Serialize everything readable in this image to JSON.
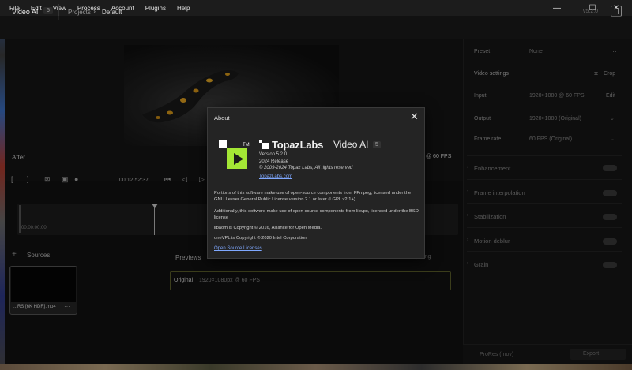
{
  "menu": [
    "File",
    "Edit",
    "View",
    "Process",
    "Account",
    "Plugins",
    "Help"
  ],
  "window_controls": {
    "minimize": "—",
    "maximize": "☐",
    "close": "✕"
  },
  "header": {
    "app_title": "Video AI",
    "app_badge": "5",
    "breadcrumb_projects": "Projects",
    "breadcrumb_current": "Default",
    "version": "v5.2.0"
  },
  "preview": {
    "after_label": "After",
    "fps_label": "@ 60 FPS",
    "timecode": "00:12:52:37",
    "timeline_start": "00:00:00:00"
  },
  "sources": {
    "label": "Sources",
    "file_name": "...RS [6K HDR].mp4",
    "menu": "···"
  },
  "previews": {
    "label": "Previews",
    "comparing_label": "Not comparing",
    "original_label": "Original",
    "original_spec": "1920×1080px @ 60 FPS"
  },
  "right_panel": {
    "preset_label": "Preset",
    "preset_value": "None",
    "preset_menu": "···",
    "video_settings_label": "Video settings",
    "crop_label": "Crop",
    "input_label": "Input",
    "input_value": "1920×1080 @ 60 FPS",
    "input_action": "Edit",
    "output_label": "Output",
    "output_value": "1920×1080 (Original)",
    "framerate_label": "Frame rate",
    "framerate_value": "60 FPS (Original)",
    "sections": [
      "Enhancement",
      "Frame interpolation",
      "Stabilization",
      "Motion deblur",
      "Grain"
    ],
    "export_codec": "ProRes (mov)",
    "export_label": "Export"
  },
  "about": {
    "title": "About",
    "brand": "TopazLabs",
    "product": "Video AI",
    "badge": "5",
    "version": "Version 5.2.0",
    "release": "2024 Release",
    "copyright": "© 2009-2024 Topaz Labs, All rights reserved",
    "site_link": "TopazLabs.com",
    "para_ffmpeg": "Portions of this software make use of open-source components from FFmpeg, licensed under the GNU Lesser General Public License version 2.1 or later (LGPL v2.1+)",
    "para_libvpx": "Additionally, this software make use of open-source components from libvpx, licensed under the BSD license",
    "para_libaom": "libaom is Copyright © 2016, Alliance for Open Media.",
    "para_onevpl": "oneVPL is Copyright © 2020 Intel Corporation",
    "licenses_link": "Open Source Licenses"
  },
  "colors": {
    "accent_green": "#a3e635",
    "link_blue": "#7fa8ff",
    "background": "#121212"
  }
}
